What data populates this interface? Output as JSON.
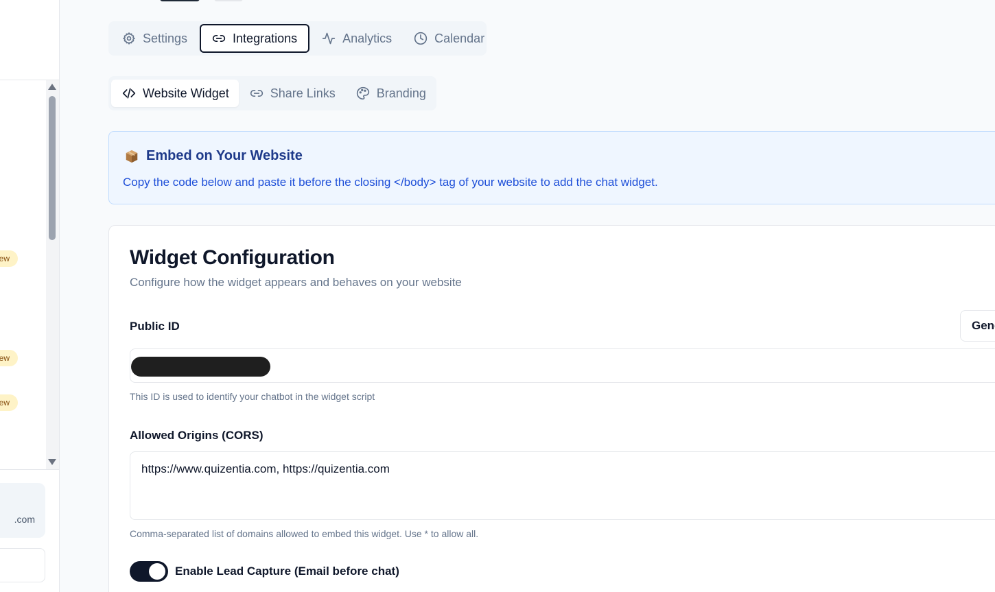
{
  "sidebar": {
    "badges": [
      "ew",
      "ew",
      "ew"
    ],
    "account_email_fragment": ".com"
  },
  "tabs": [
    {
      "label": "Settings",
      "icon": "gear-icon"
    },
    {
      "label": "Integrations",
      "icon": "link-icon",
      "active": true
    },
    {
      "label": "Analytics",
      "icon": "activity-icon"
    },
    {
      "label": "Calendar",
      "icon": "clock-icon"
    }
  ],
  "subtabs": [
    {
      "label": "Website Widget",
      "icon": "code-icon",
      "active": true
    },
    {
      "label": "Share Links",
      "icon": "link-icon"
    },
    {
      "label": "Branding",
      "icon": "palette-icon"
    }
  ],
  "banner": {
    "icon": "package-icon",
    "title": "Embed on Your Website",
    "description": "Copy the code below and paste it before the closing </body> tag of your website to add the chat widget."
  },
  "config": {
    "title": "Widget Configuration",
    "subtitle": "Configure how the widget appears and behaves on your website",
    "public_id": {
      "label": "Public ID",
      "generate_button": "Gene",
      "hint": "This ID is used to identify your chatbot in the widget script"
    },
    "allowed_origins": {
      "label": "Allowed Origins (CORS)",
      "value": "https://www.quizentia.com, https://quizentia.com",
      "hint": "Comma-separated list of domains allowed to embed this widget. Use * to allow all."
    },
    "lead_capture": {
      "label": "Enable Lead Capture (Email before chat)",
      "enabled": true
    }
  },
  "colors": {
    "primary": "#0f172a",
    "banner_bg": "#eff6ff",
    "banner_title": "#1e3a8a",
    "banner_text": "#1d4ed8",
    "badge_bg": "#fef3c7",
    "muted": "#64748b"
  }
}
